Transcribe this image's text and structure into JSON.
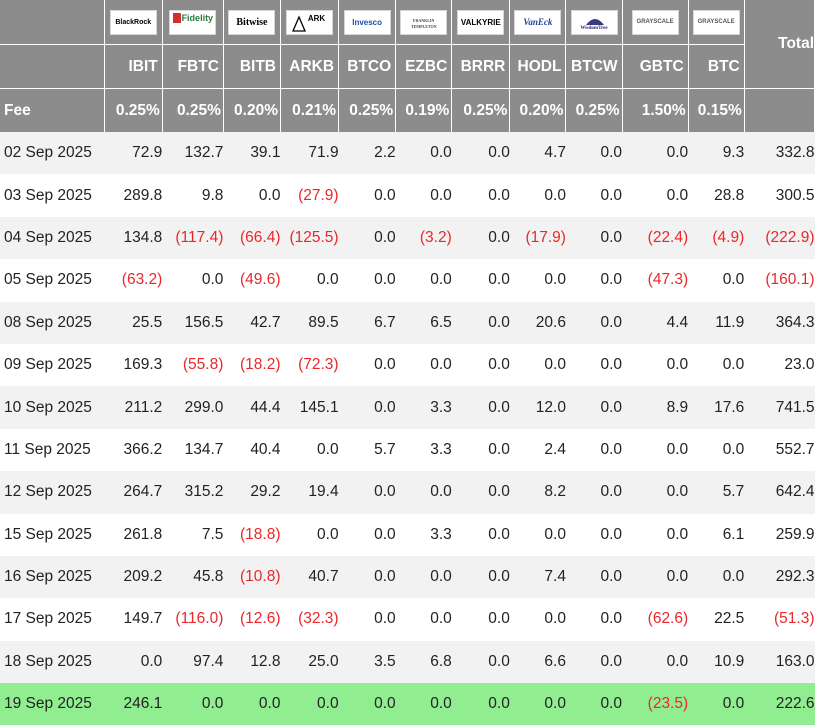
{
  "header": {
    "total_label": "Total",
    "fee_label": "Fee",
    "issuers": [
      {
        "key": "ibit",
        "logo": "blackrock-logo",
        "logo_text": "BlackRock"
      },
      {
        "key": "fbtc",
        "logo": "fidelity-logo",
        "logo_text": "Fidelity"
      },
      {
        "key": "bitb",
        "logo": "bitwise-logo",
        "logo_text": "Bitwise"
      },
      {
        "key": "arkb",
        "logo": "ark-invest-logo",
        "logo_text": "ARK"
      },
      {
        "key": "btco",
        "logo": "invesco-logo",
        "logo_text": "Invesco"
      },
      {
        "key": "ezbc",
        "logo": "franklin-templeton-logo",
        "logo_text": "FRANKLIN TEMPLETON"
      },
      {
        "key": "brrr",
        "logo": "valkyrie-logo",
        "logo_text": "VALKYRIE"
      },
      {
        "key": "hodl",
        "logo": "vaneck-logo",
        "logo_text": "VanEck"
      },
      {
        "key": "btcw",
        "logo": "wisdomtree-logo",
        "logo_text": "WisdomTree"
      },
      {
        "key": "gbtc",
        "logo": "grayscale-logo",
        "logo_text": "GRAYSCALE"
      },
      {
        "key": "btc",
        "logo": "grayscale-logo",
        "logo_text": "GRAYSCALE"
      }
    ],
    "tickers": [
      "IBIT",
      "FBTC",
      "BITB",
      "ARKB",
      "BTCO",
      "EZBC",
      "BRRR",
      "HODL",
      "BTCW",
      "GBTC",
      "BTC"
    ],
    "fees": [
      "0.25%",
      "0.25%",
      "0.20%",
      "0.21%",
      "0.25%",
      "0.19%",
      "0.25%",
      "0.20%",
      "0.25%",
      "1.50%",
      "0.15%"
    ]
  },
  "rows": [
    {
      "date": "02 Sep 2025",
      "cells": [
        "72.9",
        "132.7",
        "39.1",
        "71.9",
        "2.2",
        "0.0",
        "0.0",
        "4.7",
        "0.0",
        "0.0",
        "9.3"
      ],
      "total": "332.8"
    },
    {
      "date": "03 Sep 2025",
      "cells": [
        "289.8",
        "9.8",
        "0.0",
        "(27.9)",
        "0.0",
        "0.0",
        "0.0",
        "0.0",
        "0.0",
        "0.0",
        "28.8"
      ],
      "total": "300.5"
    },
    {
      "date": "04 Sep 2025",
      "cells": [
        "134.8",
        "(117.4)",
        "(66.4)",
        "(125.5)",
        "0.0",
        "(3.2)",
        "0.0",
        "(17.9)",
        "0.0",
        "(22.4)",
        "(4.9)"
      ],
      "total": "(222.9)"
    },
    {
      "date": "05 Sep 2025",
      "cells": [
        "(63.2)",
        "0.0",
        "(49.6)",
        "0.0",
        "0.0",
        "0.0",
        "0.0",
        "0.0",
        "0.0",
        "(47.3)",
        "0.0"
      ],
      "total": "(160.1)"
    },
    {
      "date": "08 Sep 2025",
      "cells": [
        "25.5",
        "156.5",
        "42.7",
        "89.5",
        "6.7",
        "6.5",
        "0.0",
        "20.6",
        "0.0",
        "4.4",
        "11.9"
      ],
      "total": "364.3"
    },
    {
      "date": "09 Sep 2025",
      "cells": [
        "169.3",
        "(55.8)",
        "(18.2)",
        "(72.3)",
        "0.0",
        "0.0",
        "0.0",
        "0.0",
        "0.0",
        "0.0",
        "0.0"
      ],
      "total": "23.0"
    },
    {
      "date": "10 Sep 2025",
      "cells": [
        "211.2",
        "299.0",
        "44.4",
        "145.1",
        "0.0",
        "3.3",
        "0.0",
        "12.0",
        "0.0",
        "8.9",
        "17.6"
      ],
      "total": "741.5"
    },
    {
      "date": "11 Sep 2025",
      "cells": [
        "366.2",
        "134.7",
        "40.4",
        "0.0",
        "5.7",
        "3.3",
        "0.0",
        "2.4",
        "0.0",
        "0.0",
        "0.0"
      ],
      "total": "552.7"
    },
    {
      "date": "12 Sep 2025",
      "cells": [
        "264.7",
        "315.2",
        "29.2",
        "19.4",
        "0.0",
        "0.0",
        "0.0",
        "8.2",
        "0.0",
        "0.0",
        "5.7"
      ],
      "total": "642.4"
    },
    {
      "date": "15 Sep 2025",
      "cells": [
        "261.8",
        "7.5",
        "(18.8)",
        "0.0",
        "0.0",
        "3.3",
        "0.0",
        "0.0",
        "0.0",
        "0.0",
        "6.1"
      ],
      "total": "259.9"
    },
    {
      "date": "16 Sep 2025",
      "cells": [
        "209.2",
        "45.8",
        "(10.8)",
        "40.7",
        "0.0",
        "0.0",
        "0.0",
        "7.4",
        "0.0",
        "0.0",
        "0.0"
      ],
      "total": "292.3"
    },
    {
      "date": "17 Sep 2025",
      "cells": [
        "149.7",
        "(116.0)",
        "(12.6)",
        "(32.3)",
        "0.0",
        "0.0",
        "0.0",
        "0.0",
        "0.0",
        "(62.6)",
        "22.5"
      ],
      "total": "(51.3)"
    },
    {
      "date": "18 Sep 2025",
      "cells": [
        "0.0",
        "97.4",
        "12.8",
        "25.0",
        "3.5",
        "6.8",
        "0.0",
        "6.6",
        "0.0",
        "0.0",
        "10.9"
      ],
      "total": "163.0"
    },
    {
      "date": "19 Sep 2025",
      "cells": [
        "246.1",
        "0.0",
        "0.0",
        "0.0",
        "0.0",
        "0.0",
        "0.0",
        "0.0",
        "0.0",
        "(23.5)",
        "0.0"
      ],
      "total": "222.6",
      "highlight": true
    }
  ],
  "colors": {
    "header_bg": "#8c8c8c",
    "row_alt_bg": "#f2f2f2",
    "highlight_bg": "#90ee90",
    "negative_text": "#e8282a",
    "text": "#222222"
  }
}
